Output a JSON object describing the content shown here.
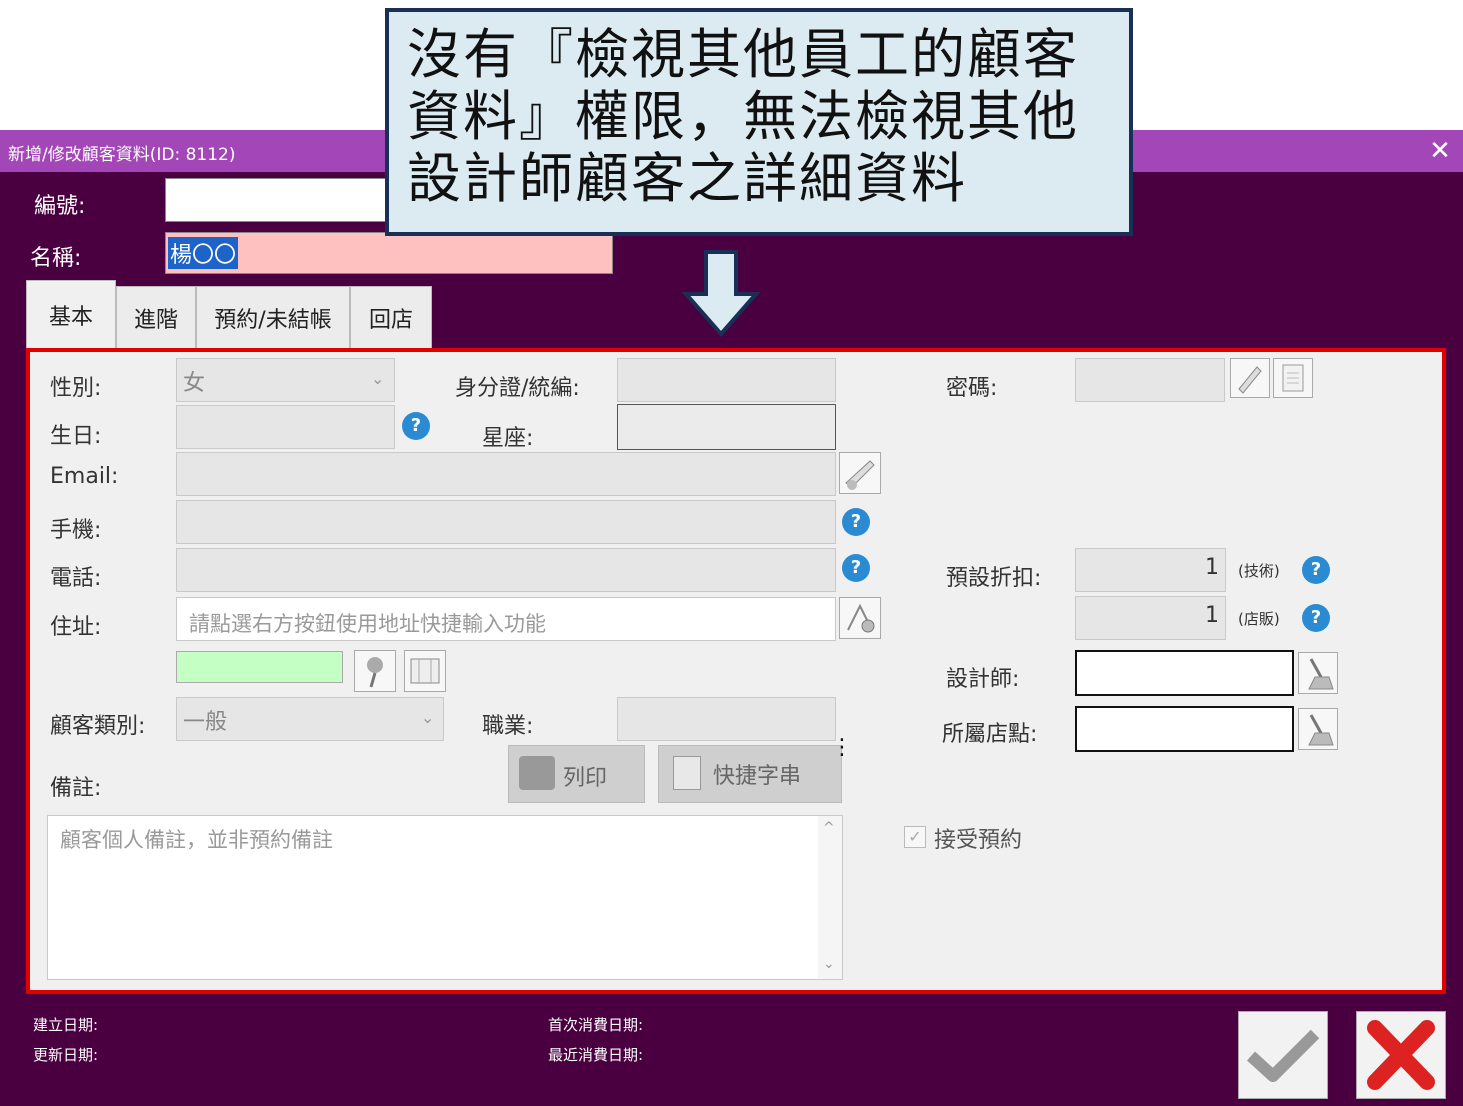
{
  "window": {
    "title": "新增/修改顧客資料(ID: 8112)",
    "close_icon": "close-icon"
  },
  "header": {
    "number_label": "編號:",
    "number_value": "",
    "name_label": "名稱:",
    "name_value": "楊〇〇"
  },
  "tabs": [
    {
      "label": "基本",
      "active": true
    },
    {
      "label": "進階",
      "active": false
    },
    {
      "label": "預約/未結帳",
      "active": false
    },
    {
      "label": "回店",
      "active": false
    }
  ],
  "callout": {
    "text_line1": "沒有『檢視其他員工的顧客",
    "text_line2": "資料』權限，無法檢視其他",
    "text_line3": "設計師顧客之詳細資料"
  },
  "form": {
    "gender_label": "性別:",
    "gender_value": "女",
    "id_label": "身分證/統編:",
    "id_value": "",
    "password_label": "密碼:",
    "password_value": "",
    "birthday_label": "生日:",
    "birthday_value": "",
    "zodiac_label": "星座:",
    "zodiac_value": "",
    "email_label": "Email:",
    "email_value": "",
    "mobile_label": "手機:",
    "mobile_value": "",
    "phone_label": "電話:",
    "phone_value": "",
    "address_label": "住址:",
    "address_placeholder": "請點選右方按鈕使用地址快捷輸入功能",
    "category_label": "顧客類別:",
    "category_value": "一般",
    "job_label": "職業:",
    "job_value": "",
    "remark_label": "備註:",
    "remark_placeholder": "顧客個人備註，並非預約備註",
    "print_button": "列印",
    "shortcut_button": "快捷字串",
    "discount_label": "預設折扣:",
    "discount_tech_value": "1",
    "discount_tech_unit": "(技術)",
    "discount_retail_value": "1",
    "discount_retail_unit": "(店販)",
    "designer_label": "設計師:",
    "designer_value": "",
    "store_label": "所屬店點:",
    "store_value": "",
    "accept_booking_label": "接受預約",
    "accept_booking_checked": true
  },
  "footer": {
    "created_label": "建立日期:",
    "updated_label": "更新日期:",
    "first_visit_label": "首次消費日期:",
    "last_visit_label": "最近消費日期:"
  },
  "colors": {
    "title_bar": "#a347b8",
    "window_bg": "#4a0040",
    "highlight_frame": "#e00000",
    "callout_bg": "#dceaf2"
  }
}
